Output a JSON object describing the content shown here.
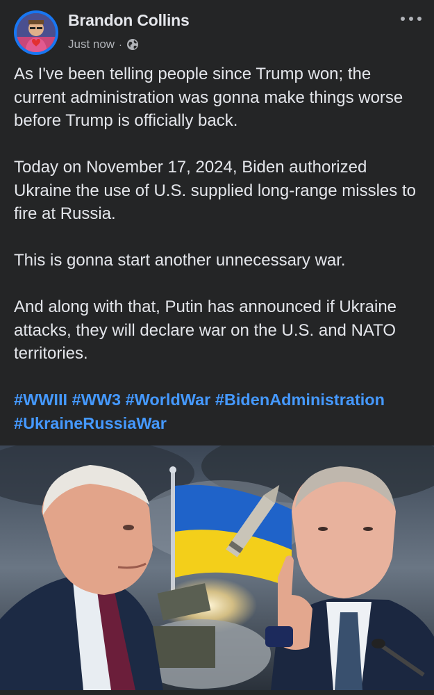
{
  "post": {
    "author": "Brandon Collins",
    "timestamp": "Just now",
    "separator": "·",
    "privacy_icon": "globe-icon",
    "more_icon": "more-options-icon",
    "paragraphs": [
      "As I've been telling people since Trump won; the current administration was gonna make things worse before Trump is officially back.",
      "Today on November 17, 2024, Biden authorized Ukraine the use of U.S. supplied long-range missles to fire at Russia.",
      "This is gonna start another unnecessary war.",
      "And along with that, Putin has announced if Ukraine attacks, they will declare war on the U.S. and NATO territories."
    ],
    "hashtags": [
      "#WWIII",
      "#WW3",
      "#WorldWar",
      "#BidenAdministration",
      "#UkraineRussiaWar"
    ],
    "image_subject": "biden-putin-ukraine-flag-missile-photo"
  },
  "colors": {
    "background": "#242526",
    "text": "#e4e6eb",
    "secondary_text": "#b0b3b8",
    "hashtag": "#4599ff",
    "avatar_ring": "#1877f2"
  }
}
